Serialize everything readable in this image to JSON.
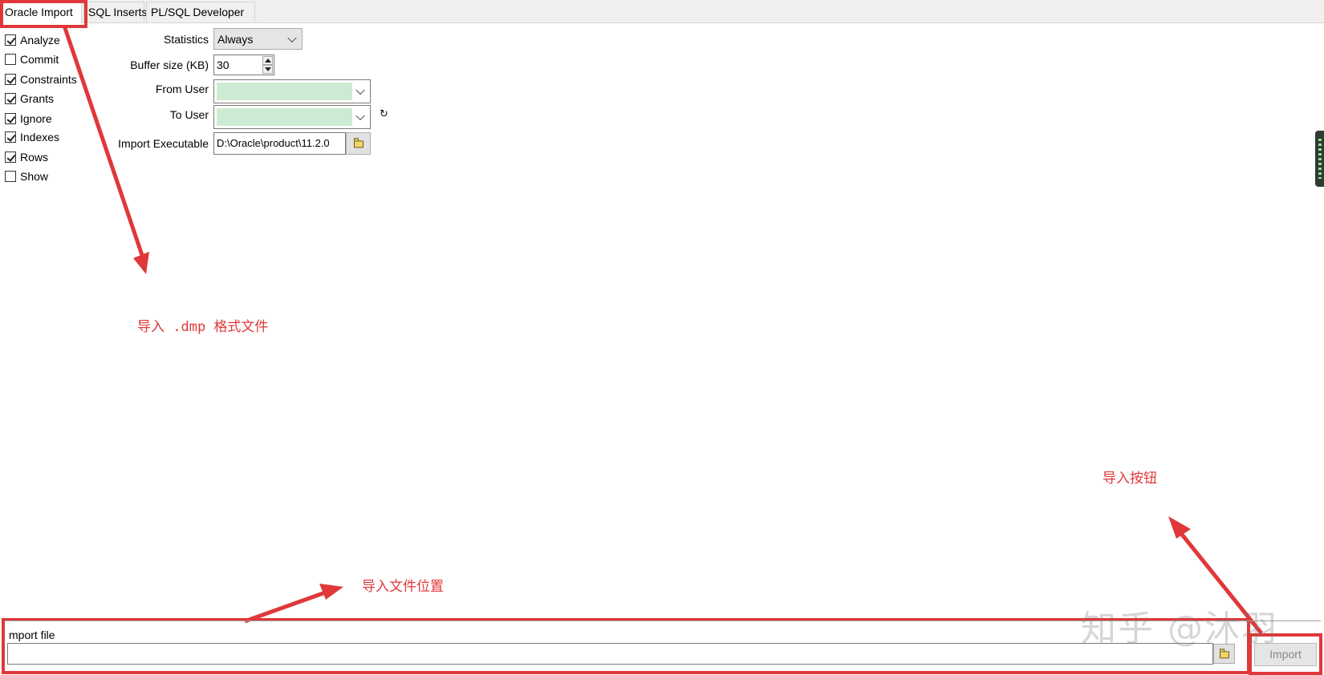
{
  "tabs": [
    {
      "label": "Oracle Import",
      "active": true
    },
    {
      "label": "SQL Inserts",
      "active": false
    },
    {
      "label": "PL/SQL Developer",
      "active": false
    }
  ],
  "options": [
    {
      "label": "Analyze",
      "checked": true
    },
    {
      "label": "Commit",
      "checked": false
    },
    {
      "label": "Constraints",
      "checked": true
    },
    {
      "label": "Grants",
      "checked": true
    },
    {
      "label": "Ignore",
      "checked": true
    },
    {
      "label": "Indexes",
      "checked": true
    },
    {
      "label": "Rows",
      "checked": true
    },
    {
      "label": "Show",
      "checked": false
    }
  ],
  "form": {
    "statistics_label": "Statistics",
    "statistics_value": "Always",
    "buffer_label": "Buffer size (KB)",
    "buffer_value": "30",
    "from_user_label": "From User",
    "from_user_value": "",
    "to_user_label": "To User",
    "to_user_value": "",
    "import_exec_label": "Import Executable",
    "import_exec_value": "D:\\Oracle\\product\\11.2.0"
  },
  "import_file": {
    "label": "mport file",
    "value": ""
  },
  "import_button_label": "Import",
  "annotations": {
    "dmp_note": "导入 .dmp 格式文件",
    "button_note": "导入按钮",
    "file_note": "导入文件位置"
  },
  "watermark": "知乎 @沐羽",
  "colors": {
    "annotation_red": "#e0383a",
    "combo_fill_green": "#cdebd3",
    "tab_bar": "#f0f0f0"
  }
}
